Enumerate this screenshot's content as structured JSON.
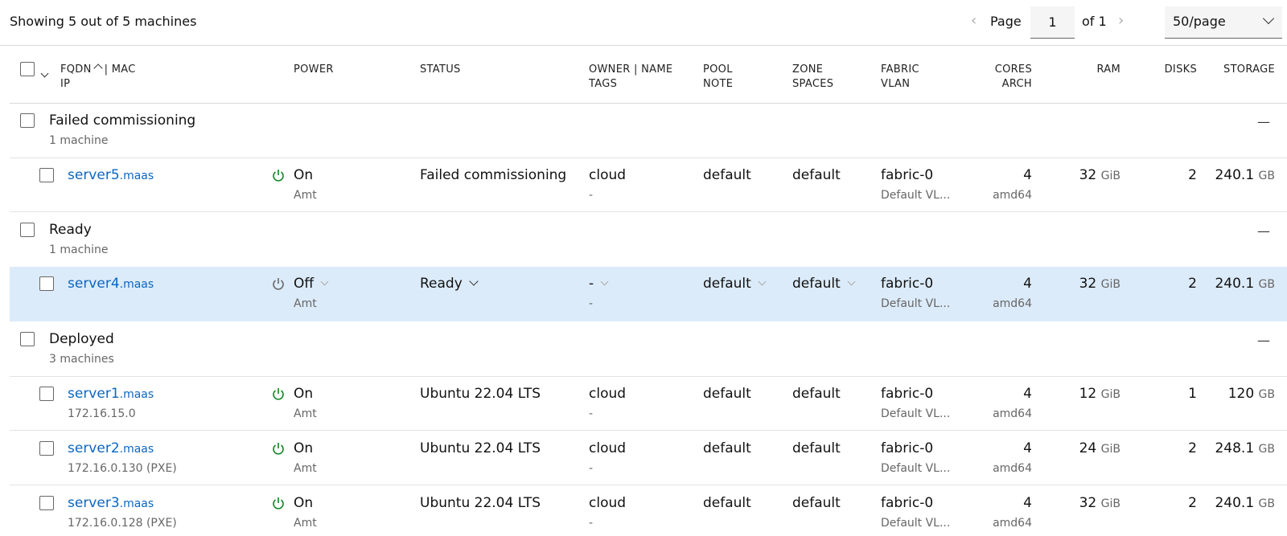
{
  "summary": "Showing 5 out of 5 machines",
  "pager": {
    "page_label": "Page",
    "page_value": "1",
    "of_label": "of 1",
    "per_page": "50/page"
  },
  "headers": {
    "fqdn": "FQDN",
    "mac": "| MAC",
    "ip": "IP",
    "power": "POWER",
    "status": "STATUS",
    "owner": "OWNER | NAME",
    "tags": "TAGS",
    "pool": "POOL",
    "note": "NOTE",
    "zone": "ZONE",
    "spaces": "SPACES",
    "fabric": "FABRIC",
    "vlan": "VLAN",
    "cores": "CORES",
    "arch": "ARCH",
    "ram": "RAM",
    "disks": "DISKS",
    "storage": "STORAGE"
  },
  "groups": [
    {
      "title": "Failed commissioning",
      "count": "1 machine",
      "dash": "—"
    },
    {
      "title": "Ready",
      "count": "1 machine",
      "dash": "—"
    },
    {
      "title": "Deployed",
      "count": "3 machines",
      "dash": "—"
    }
  ],
  "machines": [
    {
      "host": "server5",
      "domain": ".maas",
      "ip": "",
      "power": "On",
      "power_type": "Amt",
      "status": "Failed commissioning",
      "owner": "cloud",
      "tags": "-",
      "pool": "default",
      "zone": "default",
      "fabric": "fabric-0",
      "vlan": "Default VL...",
      "cores": "4",
      "arch": "amd64",
      "ram": "32",
      "ram_unit": "GiB",
      "disks": "2",
      "storage": "240.1",
      "storage_unit": "GB"
    },
    {
      "host": "server4",
      "domain": ".maas",
      "ip": "",
      "power": "Off",
      "power_type": "Amt",
      "status": "Ready",
      "owner": "-",
      "tags": "-",
      "pool": "default",
      "zone": "default",
      "fabric": "fabric-0",
      "vlan": "Default VL...",
      "cores": "4",
      "arch": "amd64",
      "ram": "32",
      "ram_unit": "GiB",
      "disks": "2",
      "storage": "240.1",
      "storage_unit": "GB"
    },
    {
      "host": "server1",
      "domain": ".maas",
      "ip": "172.16.15.0",
      "power": "On",
      "power_type": "Amt",
      "status": "Ubuntu 22.04 LTS",
      "owner": "cloud",
      "tags": "-",
      "pool": "default",
      "zone": "default",
      "fabric": "fabric-0",
      "vlan": "Default VL...",
      "cores": "4",
      "arch": "amd64",
      "ram": "12",
      "ram_unit": "GiB",
      "disks": "1",
      "storage": "120",
      "storage_unit": "GB"
    },
    {
      "host": "server2",
      "domain": ".maas",
      "ip": "172.16.0.130 (PXE)",
      "power": "On",
      "power_type": "Amt",
      "status": "Ubuntu 22.04 LTS",
      "owner": "cloud",
      "tags": "-",
      "pool": "default",
      "zone": "default",
      "fabric": "fabric-0",
      "vlan": "Default VL...",
      "cores": "4",
      "arch": "amd64",
      "ram": "24",
      "ram_unit": "GiB",
      "disks": "2",
      "storage": "248.1",
      "storage_unit": "GB"
    },
    {
      "host": "server3",
      "domain": ".maas",
      "ip": "172.16.0.128 (PXE)",
      "power": "On",
      "power_type": "Amt",
      "status": "Ubuntu 22.04 LTS",
      "owner": "cloud",
      "tags": "-",
      "pool": "default",
      "zone": "default",
      "fabric": "fabric-0",
      "vlan": "Default VL...",
      "cores": "4",
      "arch": "amd64",
      "ram": "32",
      "ram_unit": "GiB",
      "disks": "2",
      "storage": "240.1",
      "storage_unit": "GB"
    }
  ],
  "colors": {
    "link": "#0b66c2",
    "power_on": "#0e8420",
    "power_off": "#666666",
    "highlight": "#dcebf9"
  }
}
